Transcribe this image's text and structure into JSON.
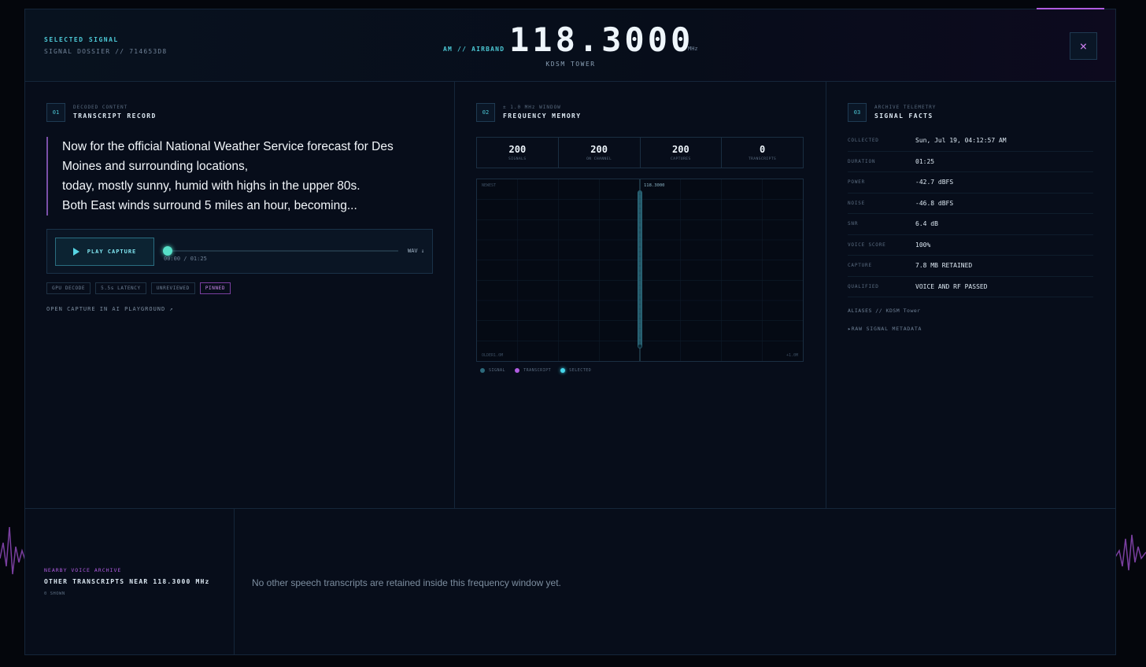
{
  "header": {
    "selected_label": "SELECTED SIGNAL",
    "dossier": "SIGNAL DOSSIER // 714653D8",
    "band": "AM // AIRBAND",
    "frequency": "118.3000",
    "unit": "MHz",
    "station": "KDSM TOWER",
    "close_label": "×"
  },
  "transcript": {
    "num": "01",
    "kicker": "DECODED CONTENT",
    "title": "TRANSCRIPT RECORD",
    "lines": [
      "Now for the official National Weather Service forecast for Des",
      "Moines and surrounding locations,",
      "today, mostly sunny, humid with highs in the upper 80s.",
      "Both East winds surround 5 miles an hour, becoming..."
    ],
    "play_label": "PLAY CAPTURE",
    "time": "00:00 / 01:25",
    "progress": 0,
    "wav_label": "WAV ↓",
    "tags": [
      "GPU DECODE",
      "5.5s LATENCY",
      "UNREVIEWED",
      "PINNED"
    ],
    "open_link": "OPEN CAPTURE IN AI PLAYGROUND ↗"
  },
  "frequency_memory": {
    "num": "02",
    "kicker": "± 1.0 MHz WINDOW",
    "title": "FREQUENCY MEMORY",
    "stats": [
      {
        "value": "200",
        "label": "SIGNALS"
      },
      {
        "value": "200",
        "label": "ON CHANNEL"
      },
      {
        "value": "200",
        "label": "CAPTURES"
      },
      {
        "value": "0",
        "label": "TRANSCRIPTS"
      }
    ],
    "legend": [
      "SIGNAL",
      "TRANSCRIPT",
      "SELECTED"
    ],
    "colors": {
      "signal": "#2d6a7c",
      "transcript": "#b05ce0",
      "selected": "#45d6ea"
    }
  },
  "chart_data": {
    "type": "scatter",
    "top_label": "NEWEST",
    "marker_label": "118.3000",
    "x_left_label": "OLDER1.0M",
    "x_right_label": "+1.0M",
    "xlim": [
      -1.0,
      1.0
    ],
    "x_offset_mhz": 0.0,
    "count": 200
  },
  "facts": {
    "num": "03",
    "kicker": "ARCHIVE TELEMETRY",
    "title": "SIGNAL FACTS",
    "rows": [
      {
        "k": "COLLECTED",
        "v": "Sun, Jul 19, 04:12:57 AM"
      },
      {
        "k": "DURATION",
        "v": "01:25"
      },
      {
        "k": "POWER",
        "v": "-42.7 dBFS"
      },
      {
        "k": "NOISE",
        "v": "-46.8 dBFS"
      },
      {
        "k": "SNR",
        "v": "6.4 dB"
      },
      {
        "k": "VOICE SCORE",
        "v": "100%"
      },
      {
        "k": "CAPTURE",
        "v": "7.8 MB RETAINED"
      },
      {
        "k": "QUALIFIED",
        "v": "VOICE AND RF PASSED"
      }
    ],
    "aliases": "ALIASES // KDSM Tower",
    "raw": "▸RAW SIGNAL METADATA"
  },
  "nearby": {
    "kicker": "NEARBY VOICE ARCHIVE",
    "title": "OTHER TRANSCRIPTS NEAR 118.3000 MHz",
    "count": "0 SHOWN",
    "empty": "No other speech transcripts are retained inside this frequency window yet."
  }
}
